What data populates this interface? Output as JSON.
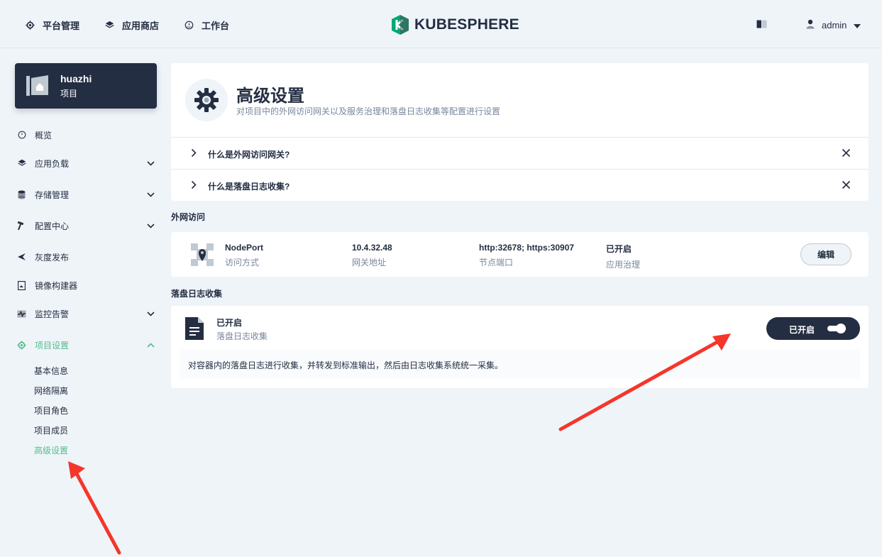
{
  "topnav": {
    "platform_label": "平台管理",
    "appstore_label": "应用商店",
    "workbench_label": "工作台",
    "logo_text": "KUBESPHERE",
    "user_name": "admin"
  },
  "project": {
    "name": "huazhi",
    "type": "项目"
  },
  "sidebar": {
    "items": [
      {
        "label": "概览",
        "icon": "dashboard-icon"
      },
      {
        "label": "应用负载",
        "icon": "appstore-icon"
      },
      {
        "label": "存储管理",
        "icon": "database-icon"
      },
      {
        "label": "配置中心",
        "icon": "hammer-icon"
      },
      {
        "label": "灰度发布",
        "icon": "bird-icon"
      },
      {
        "label": "镜像构建器",
        "icon": "image-builder-icon"
      },
      {
        "label": "监控告警",
        "icon": "monitor-icon"
      },
      {
        "label": "项目设置",
        "icon": "gear-icon"
      }
    ],
    "sub_items": [
      "基本信息",
      "网络隔离",
      "项目角色",
      "项目成员",
      "高级设置"
    ]
  },
  "header": {
    "title": "高级设置",
    "description": "对项目中的外网访问网关以及服务治理和落盘日志收集等配置进行设置"
  },
  "faq": [
    {
      "question": "什么是外网访问网关?"
    },
    {
      "question": "什么是落盘日志收集?"
    }
  ],
  "gateway": {
    "section_title": "外网访问",
    "mode_value": "NodePort",
    "mode_label": "访问方式",
    "address_value": "10.4.32.48",
    "address_label": "网关地址",
    "ports_value": "http:32678; https:30907",
    "ports_label": "节点端口",
    "governance_value": "已开启",
    "governance_label": "应用治理",
    "edit_label": "编辑"
  },
  "log_collection": {
    "section_title": "落盘日志收集",
    "status": "已开启",
    "name": "落盘日志收集",
    "toggle_label": "已开启",
    "toggle_on": true,
    "description": "对容器内的落盘日志进行收集，并转发到标准输出，然后由日志收集系统统一采集。"
  },
  "colors": {
    "accent": "#55bc8a",
    "dark": "#242e42",
    "annotation_arrow": "#f5362a"
  }
}
